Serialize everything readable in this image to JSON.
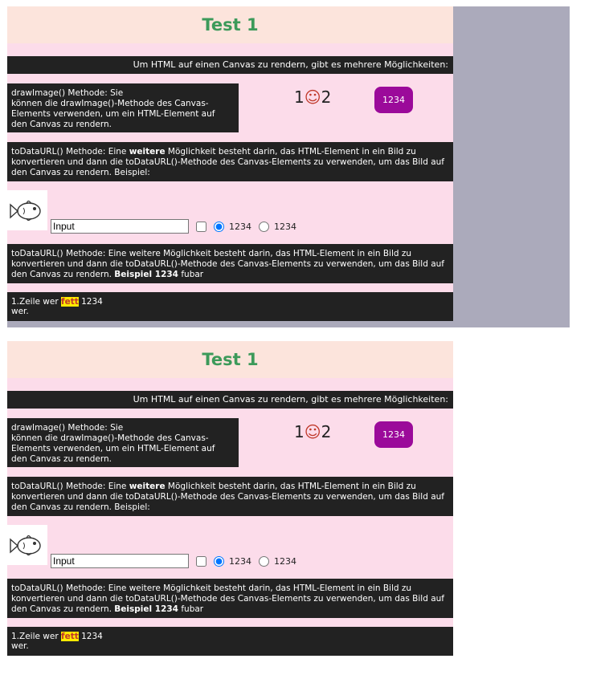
{
  "title": "Test 1",
  "intro": "Um HTML auf einen Canvas zu rendern, gibt es mehrere Möglichkeiten:",
  "draw_image": {
    "line1": "drawImage() Methode: Sie",
    "line2": "können die drawImage()-Methode des Canvas-",
    "line3": "Elements verwenden, um ein HTML-Element auf",
    "line4": "den Canvas zu rendern."
  },
  "smiley": {
    "left": "1",
    "face": "☺",
    "right": "2"
  },
  "badge": "1234",
  "todataurl_1": {
    "pre": "toDataURL() Methode: Eine ",
    "bold": "weitere",
    "post": " Möglichkeit besteht darin, das HTML-Element in ein Bild zu konvertieren und dann die toDataURL()-Methode des Canvas-Elements zu verwenden, um das Bild auf den Canvas zu rendern. Beispiel:"
  },
  "form": {
    "input_value": "Input",
    "radio1_label": "1234",
    "radio2_label": "1234"
  },
  "todataurl_2": {
    "pre": "toDataURL() Methode: Eine weitere Möglichkeit besteht darin, das HTML-Element in ein Bild zu konvertieren und dann die toDataURL()-Methode des Canvas-Elements zu verwenden, um das Bild auf den Canvas zu rendern. ",
    "bold": "Beispiel 1234",
    "post": " fubar"
  },
  "footer": {
    "pre": "1.Zeile wer ",
    "bold": "fett",
    "post": " 1234",
    "line2": "wer."
  },
  "colors": {
    "title": "#3c9a5a",
    "panel_bg": "#fcdcea",
    "title_bg": "#fce4dc",
    "dark_bar": "#222222",
    "badge": "#9b0a9a",
    "outer_frame": "#abaabb",
    "highlight": "#ffea00"
  },
  "icons": [
    "fish-icon",
    "smiley-icon"
  ]
}
